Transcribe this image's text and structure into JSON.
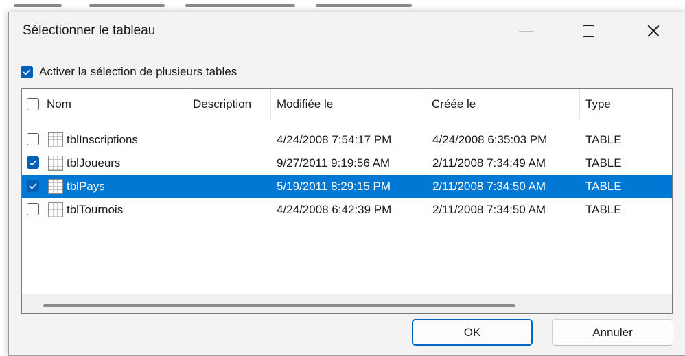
{
  "window": {
    "title": "Sélectionner le tableau"
  },
  "options": {
    "multi_select_label": "Activer la sélection de plusieurs tables",
    "multi_select_checked": true
  },
  "table": {
    "columns": [
      "Nom",
      "Description",
      "Modifiée le",
      "Créée le",
      "Type"
    ],
    "rows": [
      {
        "checked": false,
        "selected": false,
        "name": "tblInscriptions",
        "description": "",
        "modified": "4/24/2008 7:54:17 PM",
        "created": "4/24/2008 6:35:03 PM",
        "type": "TABLE"
      },
      {
        "checked": true,
        "selected": false,
        "name": "tblJoueurs",
        "description": "",
        "modified": "9/27/2011 9:19:56 AM",
        "created": "2/11/2008 7:34:49 AM",
        "type": "TABLE"
      },
      {
        "checked": true,
        "selected": true,
        "name": "tblPays",
        "description": "",
        "modified": "5/19/2011 8:29:15 PM",
        "created": "2/11/2008 7:34:50 AM",
        "type": "TABLE"
      },
      {
        "checked": false,
        "selected": false,
        "name": "tblTournois",
        "description": "",
        "modified": "4/24/2008 6:42:39 PM",
        "created": "2/11/2008 7:34:50 AM",
        "type": "TABLE"
      }
    ]
  },
  "buttons": {
    "ok_label": "OK",
    "cancel_label": "Annuler"
  },
  "colors": {
    "accent": "#005fb8",
    "selection": "#0078d4"
  },
  "icons": {
    "row_icon": "table-icon",
    "minimize": "minimize-icon",
    "maximize": "maximize-icon",
    "close": "close-icon"
  }
}
